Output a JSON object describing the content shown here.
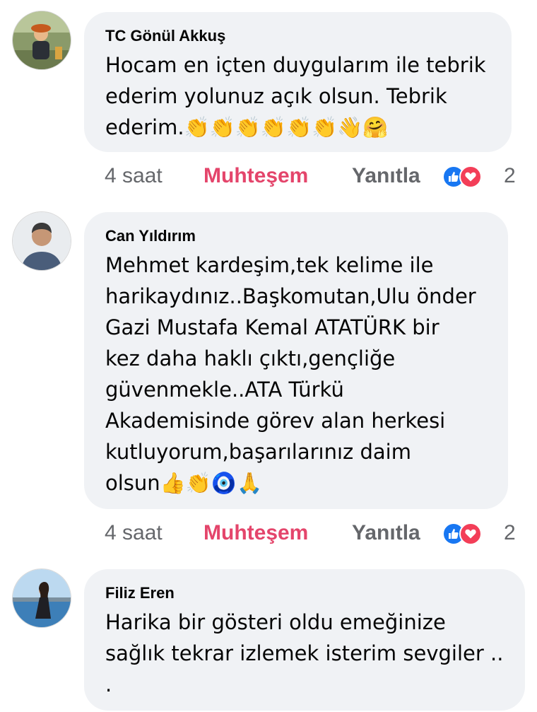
{
  "comments": [
    {
      "author": "TC Gönül Akkuş",
      "text": "Hocam en içten duygularım ile tebrik\nederim yolunuz açık olsun. Tebrik\nederim.👏👏👏👏👏👏👋🤗",
      "time": "4 saat",
      "reaction_label": "Muhteşem",
      "reply_label": "Yanıtla",
      "reaction_count": "2",
      "reaction_icons": [
        "like-icon",
        "love-icon"
      ]
    },
    {
      "author": "Can Yıldırım",
      "text": "Mehmet kardeşim,tek kelime ile\nharikaydınız..Başkomutan,Ulu önder\nGazi Mustafa Kemal ATATÜRK bir\nkez daha haklı çıktı,gençliğe\ngüvenmekle..ATA Türkü\nAkademisinde görev alan herkesi\nkutluyorum,başarılarınız daim\nolsun👍👏🧿🙏",
      "time": "4 saat",
      "reaction_label": "Muhteşem",
      "reply_label": "Yanıtla",
      "reaction_count": "2",
      "reaction_icons": [
        "like-icon",
        "love-icon"
      ]
    },
    {
      "author": "Filiz Eren",
      "text": "Harika bir gösteri oldu emeğinize\nsağlık tekrar izlemek isterim sevgiler ..\n.",
      "time": "",
      "reaction_label": "",
      "reply_label": "",
      "reaction_count": ""
    }
  ],
  "colors": {
    "bubble": "#f0f2f5",
    "reaction_highlight": "#e4456b",
    "muted": "#65676b",
    "like": "#1877f2",
    "love": "#f33e58"
  }
}
